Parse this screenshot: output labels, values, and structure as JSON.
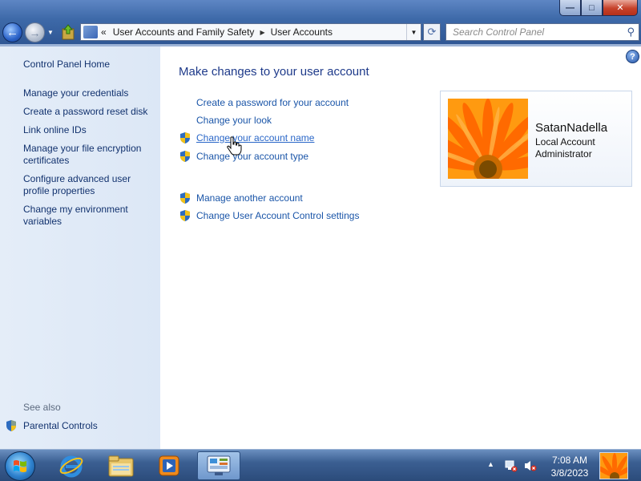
{
  "window": {
    "minimize_label": "—",
    "maximize_label": "□",
    "close_label": "✕"
  },
  "address": {
    "prefix": "«",
    "crumb1": "User Accounts and Family Safety",
    "crumb2": "User Accounts"
  },
  "search": {
    "placeholder": "Search Control Panel"
  },
  "sidebar": {
    "home": "Control Panel Home",
    "items": [
      "Manage your credentials",
      "Create a password reset disk",
      "Link online IDs",
      "Manage your file encryption certificates",
      "Configure advanced user profile properties",
      "Change my environment variables"
    ],
    "see_also_heading": "See also",
    "see_also_items": [
      "Parental Controls"
    ]
  },
  "main": {
    "heading": "Make changes to your user account",
    "tasks": [
      "Create a password for your account",
      "Change your look",
      "Change your account name",
      "Change your account type"
    ],
    "other_tasks": [
      "Manage another account",
      "Change User Account Control settings"
    ]
  },
  "user": {
    "name": "SatanNadella",
    "type": "Local Account",
    "role": "Administrator"
  },
  "taskbar": {
    "time": "7:08 AM",
    "date": "3/8/2023"
  },
  "colors": {
    "link": "#1a55a8",
    "heading": "#1e3a8a",
    "sidebar_bg": "#e4edf8",
    "taskbar": "#3b5f92"
  }
}
